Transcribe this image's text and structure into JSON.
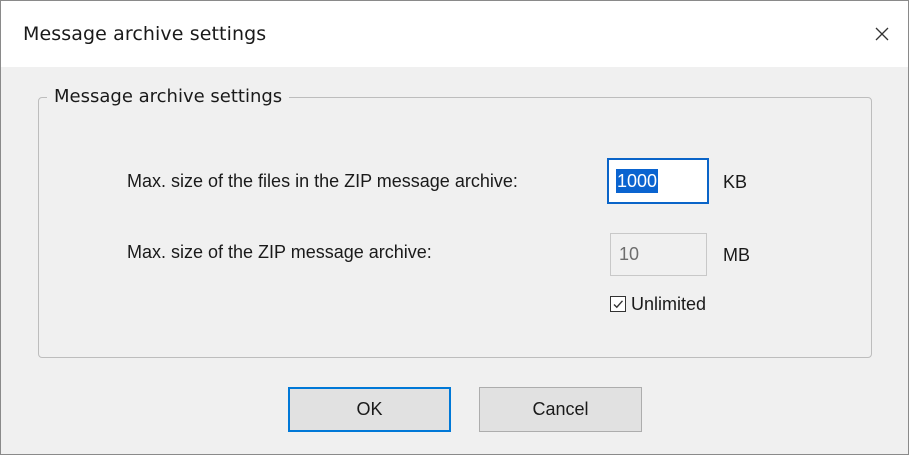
{
  "window": {
    "title": "Message archive settings",
    "close_icon": "close-icon"
  },
  "group": {
    "legend": "Message archive settings"
  },
  "files_size": {
    "label": "Max. size of the files in the ZIP message archive:",
    "value": "1000",
    "unit": "KB"
  },
  "archive_size": {
    "label": "Max. size of the ZIP message archive:",
    "value": "10",
    "unit": "MB"
  },
  "unlimited": {
    "label": "Unlimited",
    "checked": true
  },
  "buttons": {
    "ok_label": "OK",
    "cancel_label": "Cancel"
  },
  "colors": {
    "focus_border": "#0a64c8",
    "selection": "#0a64d0",
    "dialog_bg": "#f0f0f0"
  }
}
